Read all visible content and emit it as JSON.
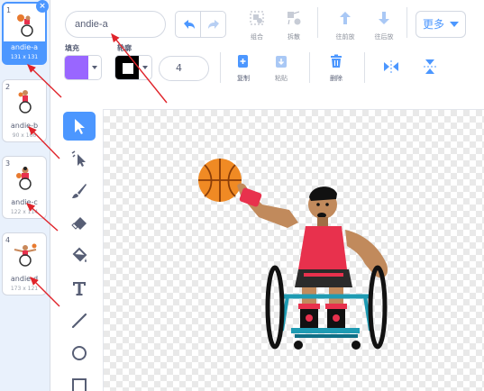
{
  "costumes": [
    {
      "num": "1",
      "name": "andie-a",
      "size": "131 x 131",
      "selected": true
    },
    {
      "num": "2",
      "name": "andie-b",
      "size": "90 x 166",
      "selected": false
    },
    {
      "num": "3",
      "name": "andie-c",
      "size": "122 x 114",
      "selected": false
    },
    {
      "num": "4",
      "name": "andie-d",
      "size": "173 x 121",
      "selected": false
    }
  ],
  "delete_glyph": "×",
  "costume_name_value": "andie-a",
  "toolbar": {
    "group_label": "组合",
    "ungroup_label": "拆散",
    "forward_label": "往前放",
    "backward_label": "往后放",
    "more_label": "更多",
    "copy_label": "复制",
    "paste_label": "粘贴",
    "delete_label": "删除"
  },
  "fill_label": "填充",
  "outline_label": "轮廓",
  "stroke_width": "4",
  "colors": {
    "accent": "#4c97ff",
    "fill": "#9966ff",
    "outline": "#000000",
    "annotation": "#e0242b"
  },
  "tools": [
    "select-icon",
    "reshape-icon",
    "brush-icon",
    "eraser-icon",
    "fill-icon",
    "text-icon",
    "line-icon",
    "circle-icon",
    "rectangle-icon"
  ]
}
